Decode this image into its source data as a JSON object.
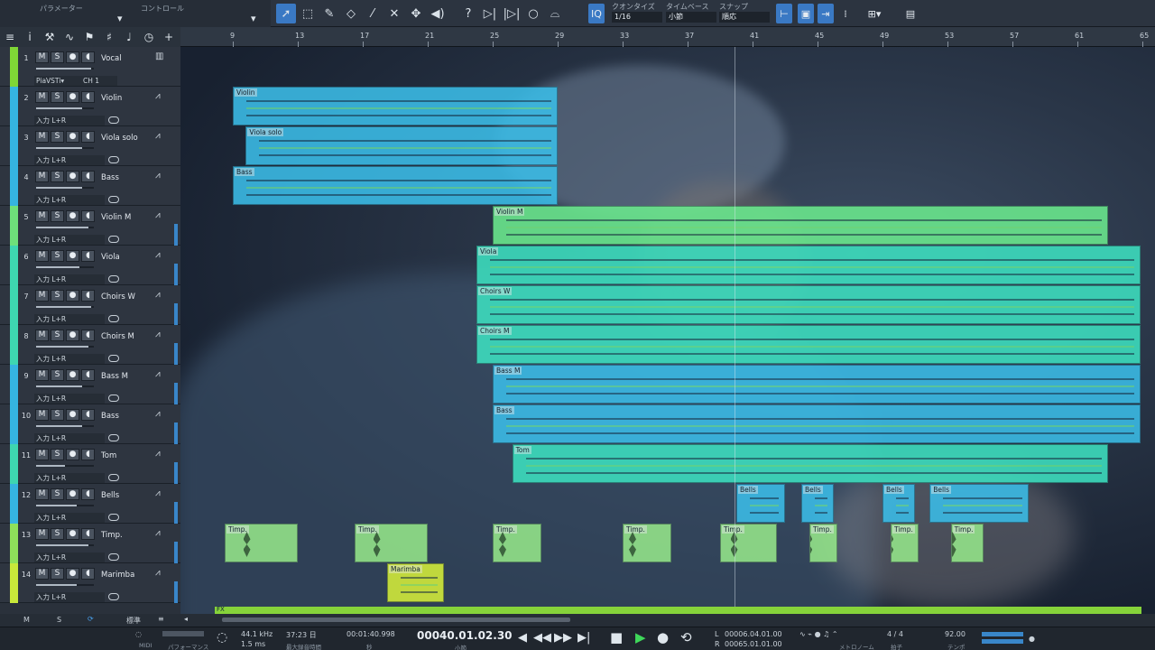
{
  "toolbar": {
    "params_label": "パラメーター",
    "control_label": "コントロール",
    "quantize": {
      "label": "クオンタイズ",
      "value": "1/16"
    },
    "timebase": {
      "label": "タイムベース",
      "value": "小節"
    },
    "snap": {
      "label": "スナップ",
      "value": "順応"
    },
    "iq_label": "IQ"
  },
  "ruler": {
    "ticks": [
      "9",
      "13",
      "17",
      "21",
      "25",
      "29",
      "33",
      "37",
      "41",
      "45",
      "49",
      "53",
      "57",
      "61",
      "65"
    ]
  },
  "tracks": [
    {
      "num": "1",
      "name": "Vocal",
      "color": "#7fd636",
      "type": "instrument",
      "io": "PiaVSTi▾",
      "ch": "CH 1",
      "fader": 0.95,
      "meter": false
    },
    {
      "num": "2",
      "name": "Violin",
      "color": "#35b4e0",
      "type": "audio",
      "io": "入力 L+R",
      "fader": 0.8,
      "meter": false
    },
    {
      "num": "3",
      "name": "Viola solo",
      "color": "#35b4e0",
      "type": "audio",
      "io": "入力 L+R",
      "fader": 0.8,
      "meter": false
    },
    {
      "num": "4",
      "name": "Bass",
      "color": "#35b4e0",
      "type": "audio",
      "io": "入力 L+R",
      "fader": 0.8,
      "meter": false
    },
    {
      "num": "5",
      "name": "Violin M",
      "color": "#6ee07a",
      "type": "audio",
      "io": "入力 L+R",
      "fader": 0.9,
      "meter": true
    },
    {
      "num": "6",
      "name": "Viola",
      "color": "#3ed6b0",
      "type": "audio",
      "io": "入力 L+R",
      "fader": 0.75,
      "meter": true
    },
    {
      "num": "7",
      "name": "Choirs W",
      "color": "#3ed6b0",
      "type": "audio",
      "io": "入力 L+R",
      "fader": 0.95,
      "meter": true
    },
    {
      "num": "8",
      "name": "Choirs M",
      "color": "#3ed6b0",
      "type": "audio",
      "io": "入力 L+R",
      "fader": 0.9,
      "meter": true
    },
    {
      "num": "9",
      "name": "Bass M",
      "color": "#35b4e0",
      "type": "audio",
      "io": "入力 L+R",
      "fader": 0.8,
      "meter": true
    },
    {
      "num": "10",
      "name": "Bass",
      "color": "#35b4e0",
      "type": "audio",
      "io": "入力 L+R",
      "fader": 0.8,
      "meter": true
    },
    {
      "num": "11",
      "name": "Tom",
      "color": "#3ed6b0",
      "type": "audio",
      "io": "入力 L+R",
      "fader": 0.5,
      "meter": true
    },
    {
      "num": "12",
      "name": "Bells",
      "color": "#35b4e0",
      "type": "audio",
      "io": "入力 L+R",
      "fader": 0.7,
      "meter": true
    },
    {
      "num": "13",
      "name": "Timp.",
      "color": "#8ee05a",
      "type": "audio",
      "io": "入力 L+R",
      "fader": 0.9,
      "meter": true
    },
    {
      "num": "14",
      "name": "Marimba",
      "color": "#c8e83a",
      "type": "audio",
      "io": "入力 L+R",
      "fader": 0.7,
      "meter": true
    }
  ],
  "clips": [
    {
      "label": "Violin",
      "track": 1,
      "start": 9,
      "end": 29,
      "color": "#3bbde8"
    },
    {
      "label": "Viola solo",
      "track": 2,
      "start": 9.8,
      "end": 29,
      "color": "#3bbde8"
    },
    {
      "label": "Bass",
      "track": 3,
      "start": 9,
      "end": 29,
      "color": "#3bbde8"
    },
    {
      "label": "Violin M",
      "track": 4,
      "start": 25,
      "end": 62.9,
      "color": "#6bea8e"
    },
    {
      "label": "Viola",
      "track": 5,
      "start": 24,
      "end": 64.9,
      "color": "#3de0c0"
    },
    {
      "label": "Choirs W",
      "track": 6,
      "start": 24,
      "end": 64.9,
      "color": "#3de0c0"
    },
    {
      "label": "Choirs M",
      "track": 7,
      "start": 24,
      "end": 64.9,
      "color": "#3de0c0"
    },
    {
      "label": "Bass M",
      "track": 8,
      "start": 25,
      "end": 64.9,
      "color": "#3bbde8"
    },
    {
      "label": "Bass",
      "track": 9,
      "start": 25,
      "end": 64.9,
      "color": "#3bbde8"
    },
    {
      "label": "Tom",
      "track": 10,
      "start": 26.2,
      "end": 62.9,
      "color": "#3de0c0"
    },
    {
      "label": "Bells",
      "track": 11,
      "start": 40,
      "end": 43,
      "color": "#3bbde8"
    },
    {
      "label": "Bells",
      "track": 11,
      "start": 44,
      "end": 46,
      "color": "#3bbde8"
    },
    {
      "label": "Bells",
      "track": 11,
      "start": 49,
      "end": 51,
      "color": "#3bbde8"
    },
    {
      "label": "Bells",
      "track": 11,
      "start": 51.9,
      "end": 58,
      "color": "#3bbde8"
    },
    {
      "label": "Timp.",
      "track": 12,
      "start": 8.5,
      "end": 13,
      "color": "#95e68a"
    },
    {
      "label": "Timp.",
      "track": 12,
      "start": 16.5,
      "end": 21,
      "color": "#95e68a"
    },
    {
      "label": "Timp.",
      "track": 12,
      "start": 25,
      "end": 28,
      "color": "#95e68a"
    },
    {
      "label": "Timp.",
      "track": 12,
      "start": 33,
      "end": 36,
      "color": "#95e68a"
    },
    {
      "label": "Timp.",
      "track": 12,
      "start": 39,
      "end": 42.5,
      "color": "#95e68a"
    },
    {
      "label": "Timp.",
      "track": 12,
      "start": 44.5,
      "end": 46.2,
      "color": "#95e68a"
    },
    {
      "label": "Timp.",
      "track": 12,
      "start": 49.5,
      "end": 51.2,
      "color": "#95e68a"
    },
    {
      "label": "Timp.",
      "track": 12,
      "start": 53.2,
      "end": 55.2,
      "color": "#95e68a"
    },
    {
      "label": "Marimba",
      "track": 13,
      "start": 18.5,
      "end": 22,
      "color": "#d4ee3a"
    }
  ],
  "fx_label": "FX",
  "bottom": {
    "m": "M",
    "s": "S",
    "zoom_label": "標準",
    "midi": "MIDI",
    "perf": "パフォーマンス",
    "rate": "44.1 kHz",
    "latency": "1.5 ms",
    "rec_time": "37:23 日",
    "rec_label": "最大録音時間",
    "seconds": "00:01:40.998",
    "seconds_label": "秒",
    "position": "00040.01.02.30",
    "position_label": "小節",
    "loop_l": "00006.04.01.00",
    "loop_r": "00065.01.01.00",
    "l": "L",
    "r": "R",
    "metronome_label": "メトロノーム",
    "time_sig": "4 / 4",
    "time_sig_label": "拍子",
    "tempo": "92.00",
    "tempo_label": "テンポ"
  }
}
